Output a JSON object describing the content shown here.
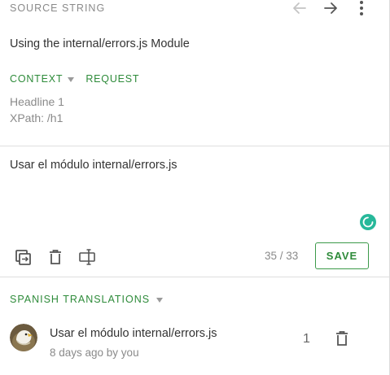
{
  "source": {
    "header_label": "SOURCE STRING",
    "text": "Using the internal/errors.js Module"
  },
  "context_links": {
    "context_label": "CONTEXT",
    "request_label": "REQUEST"
  },
  "context_info": {
    "line1": "Headline 1",
    "line2": "XPath: /h1"
  },
  "editor": {
    "translation_text": "Usar el módulo internal/errors.js",
    "char_count": "35 / 33",
    "save_label": "SAVE"
  },
  "translations_section": {
    "title": "SPANISH TRANSLATIONS",
    "items": [
      {
        "text": "Usar el módulo internal/errors.js",
        "meta": "8 days ago by you",
        "votes": "1"
      }
    ]
  },
  "icons": {
    "back": "arrow-left-icon",
    "forward": "arrow-right-icon",
    "more": "more-vertical-icon",
    "copy": "copy-source-icon",
    "clear": "trash-icon",
    "rtl": "text-direction-icon",
    "spinner": "loading-spinner-icon"
  },
  "colors": {
    "accent_green": "#2e8b3a",
    "spinner_teal": "#27b89a",
    "muted_gray": "#8a8a8a"
  }
}
